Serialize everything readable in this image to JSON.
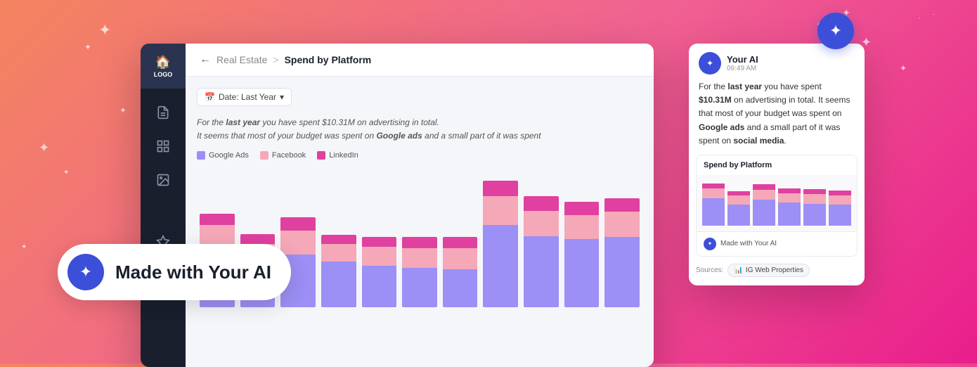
{
  "background": {
    "gradient_start": "#f4845f",
    "gradient_end": "#e91e8c"
  },
  "sidebar": {
    "logo_text": "LOGO",
    "items": [
      {
        "id": "home",
        "icon": "🏠",
        "active": false
      },
      {
        "id": "document",
        "icon": "📄",
        "active": false
      },
      {
        "id": "grid",
        "icon": "⊞",
        "active": false
      },
      {
        "id": "image",
        "icon": "🖼",
        "active": false
      },
      {
        "id": "star",
        "icon": "✦",
        "active": false
      },
      {
        "id": "chart",
        "icon": "📈",
        "active": true
      }
    ]
  },
  "breadcrumb": {
    "back_label": "←",
    "parent": "Real Estate",
    "separator": ">",
    "current": "Spend by Platform"
  },
  "filter": {
    "icon": "📅",
    "label": "Date: Last Year",
    "dropdown_icon": "▾"
  },
  "ai_summary": {
    "text_italic_start": "For the",
    "text_bold": "last year",
    "text_middle": "you have spent $10.31M  on advertising in total.",
    "text_line2": "It seems that most of your budget was spent on",
    "text_bold2": "Google ads",
    "text_end": "and a small part of it was spent"
  },
  "legend": [
    {
      "label": "Google Ads",
      "color": "#9c8ff5"
    },
    {
      "label": "Facebook",
      "color": "#f5a8b8"
    },
    {
      "label": "LinkedIn",
      "color": "#e040a0"
    }
  ],
  "chart": {
    "bars": [
      {
        "google": 55,
        "facebook": 20,
        "linkedin": 10
      },
      {
        "google": 40,
        "facebook": 18,
        "linkedin": 9
      },
      {
        "google": 48,
        "facebook": 22,
        "linkedin": 12
      },
      {
        "google": 42,
        "facebook": 16,
        "linkedin": 8
      },
      {
        "google": 38,
        "facebook": 17,
        "linkedin": 9
      },
      {
        "google": 36,
        "facebook": 18,
        "linkedin": 10
      },
      {
        "google": 35,
        "facebook": 19,
        "linkedin": 10
      },
      {
        "google": 75,
        "facebook": 26,
        "linkedin": 14
      },
      {
        "google": 65,
        "facebook": 23,
        "linkedin": 13
      },
      {
        "google": 62,
        "facebook": 22,
        "linkedin": 12
      },
      {
        "google": 64,
        "facebook": 23,
        "linkedin": 12
      }
    ]
  },
  "badge": {
    "icon": "✦",
    "text": "Made with Your AI"
  },
  "chat_panel": {
    "ai_name": "Your AI",
    "timestamp": "09:49 AM",
    "message_parts": [
      {
        "text": "For the ",
        "bold": false,
        "italic": false
      },
      {
        "text": "last year",
        "bold": true,
        "italic": false
      },
      {
        "text": " you have spent ",
        "bold": false,
        "italic": false
      },
      {
        "text": "$10.31M",
        "bold": true,
        "italic": false
      },
      {
        "text": " on advertising in total. It seems that most of your budget was spent on ",
        "bold": false,
        "italic": false
      },
      {
        "text": "Google ads",
        "bold": true,
        "italic": false
      },
      {
        "text": " and a small part of it was spent on ",
        "bold": false,
        "italic": false
      },
      {
        "text": "social media",
        "bold": true,
        "italic": false
      },
      {
        "text": ".",
        "bold": false,
        "italic": false
      }
    ],
    "mini_chart": {
      "title": "Spend by Platform",
      "bars": [
        {
          "google": 45,
          "facebook": 16,
          "linkedin": 8
        },
        {
          "google": 35,
          "facebook": 14,
          "linkedin": 7
        },
        {
          "google": 42,
          "facebook": 17,
          "linkedin": 9
        },
        {
          "google": 38,
          "facebook": 15,
          "linkedin": 8
        },
        {
          "google": 36,
          "facebook": 16,
          "linkedin": 8
        },
        {
          "google": 34,
          "facebook": 15,
          "linkedin": 8
        }
      ],
      "footer_text": "Made with Your AI"
    },
    "sources_label": "Sources:",
    "source": "IG Web Properties"
  }
}
